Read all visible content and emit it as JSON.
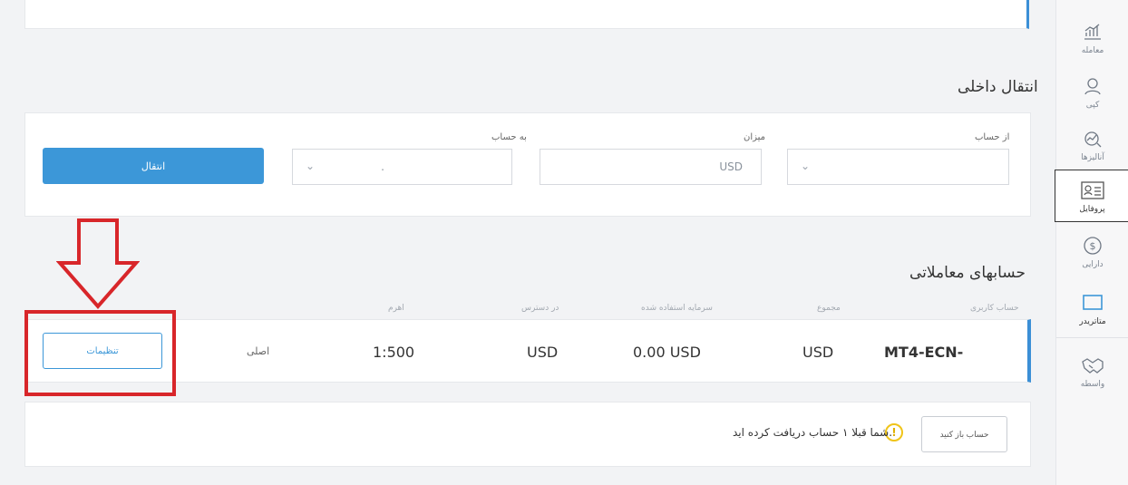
{
  "sidebar": {
    "items": [
      {
        "label": "معامله",
        "icon": "chart-icon"
      },
      {
        "label": "کپی",
        "icon": "user-icon"
      },
      {
        "label": "آنالیزها",
        "icon": "analysis-icon"
      },
      {
        "label": "پروفایل",
        "icon": "profile-card-icon",
        "active": true
      },
      {
        "label": "دارایی",
        "icon": "dollar-icon"
      },
      {
        "label": "متاتریدر",
        "icon": "monitor-icon"
      },
      {
        "label": "واسطه",
        "icon": "handshake-icon"
      }
    ]
  },
  "transfer": {
    "title": "انتقال داخلی",
    "from_label": "از حساب",
    "amount_label": "میزان",
    "amount_currency": "USD",
    "to_label": "به حساب",
    "to_value": ".",
    "button_label": "انتقال"
  },
  "accounts": {
    "title": "حسابهای معاملاتی",
    "headers": {
      "login": "حساب کاربری",
      "total": "مجموع",
      "used": "سرمایه استفاده شده",
      "available": "در دسترس",
      "leverage": "اهرم"
    },
    "row": {
      "account": "MT4-ECN-",
      "total": "USD",
      "used": "0.00 USD",
      "available": "USD",
      "leverage": "1:500",
      "type": "اصلی",
      "settings_label": "تنظیمات"
    }
  },
  "info": {
    "open_button": "حساب باز کنید",
    "message": "شما قبلا ۱ حساب دریافت کرده اید."
  },
  "colors": {
    "accent": "#3c97d8",
    "annotation": "#d8262a",
    "warning": "#f0c419"
  }
}
